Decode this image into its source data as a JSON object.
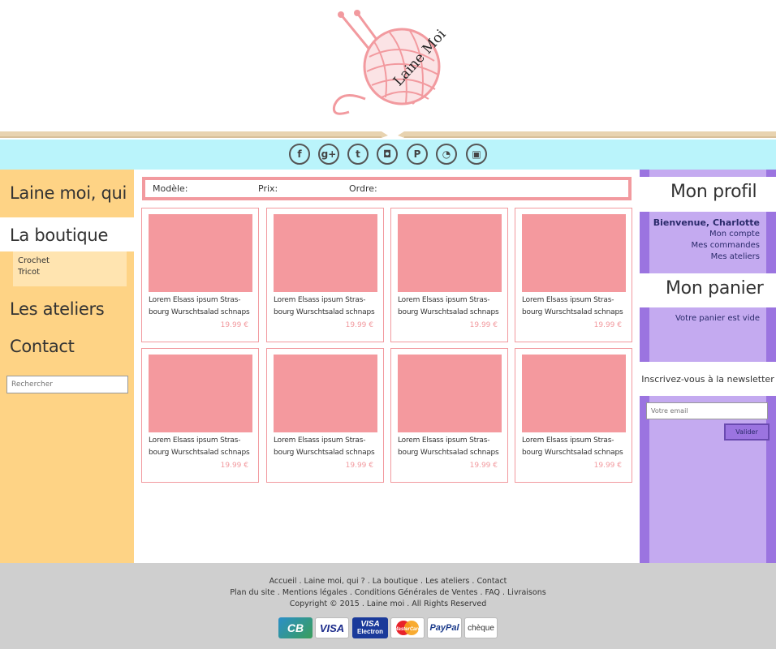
{
  "brand": {
    "logo_text": "Laine Moi",
    "colors": {
      "accent_pink": "#f29a9f",
      "sky": "#baf4fb",
      "sand": "#fed385",
      "lavender": "#c4aaf0",
      "purple": "#9b74e0"
    }
  },
  "social": [
    {
      "icon": "facebook-icon",
      "glyph": "f"
    },
    {
      "icon": "googleplus-icon",
      "glyph": "g+"
    },
    {
      "icon": "tumblr-icon",
      "glyph": "t"
    },
    {
      "icon": "instagram-icon",
      "glyph": "◘"
    },
    {
      "icon": "pinterest-icon",
      "glyph": "P"
    },
    {
      "icon": "rss-icon",
      "glyph": "◔"
    },
    {
      "icon": "youtube-icon",
      "glyph": "▣"
    }
  ],
  "nav": {
    "items": [
      "Laine moi, qui",
      "La boutique",
      "Les ateliers",
      "Contact"
    ],
    "sub": [
      "Crochet",
      "Tricot"
    ],
    "search_placeholder": "Rechercher"
  },
  "filter": {
    "model": "Modèle:",
    "price": "Prix:",
    "order": "Ordre:"
  },
  "products": [
    {
      "line1": "Lorem Elsass ipsum Stras-",
      "line2": "bourg Wurschtsalad schnaps",
      "price": "19.99 €"
    },
    {
      "line1": "Lorem Elsass ipsum Stras-",
      "line2": "bourg Wurschtsalad schnaps",
      "price": "19.99 €"
    },
    {
      "line1": "Lorem Elsass ipsum Stras-",
      "line2": "bourg Wurschtsalad schnaps",
      "price": "19.99 €"
    },
    {
      "line1": "Lorem Elsass ipsum Stras-",
      "line2": "bourg Wurschtsalad schnaps",
      "price": "19.99 €"
    },
    {
      "line1": "Lorem Elsass ipsum Stras-",
      "line2": "bourg Wurschtsalad schnaps",
      "price": "19.99 €"
    },
    {
      "line1": "Lorem Elsass ipsum Stras-",
      "line2": "bourg Wurschtsalad schnaps",
      "price": "19.99 €"
    },
    {
      "line1": "Lorem Elsass ipsum Stras-",
      "line2": "bourg Wurschtsalad schnaps",
      "price": "19.99 €"
    },
    {
      "line1": "Lorem Elsass ipsum Stras-",
      "line2": "bourg Wurschtsalad schnaps",
      "price": "19.99 €"
    }
  ],
  "profile": {
    "title": "Mon profil",
    "welcome": "Bienvenue, Charlotte",
    "links": [
      "Mon compte",
      "Mes commandes",
      "Mes ateliers"
    ]
  },
  "cart": {
    "title": "Mon panier",
    "empty": "Votre panier est vide"
  },
  "newsletter": {
    "title": "Inscrivez-vous à la newsletter",
    "placeholder": "Votre email",
    "button": "Valider"
  },
  "footer": {
    "line1": "Accueil . Laine moi, qui ? . La boutique . Les ateliers . Contact",
    "line2": "Plan du site . Mentions légales . Conditions Générales de Ventes . FAQ . Livraisons",
    "line3": "Copyright © 2015 . Laine moi . All Rights Reserved"
  },
  "payments": [
    {
      "icon": "cb-card-icon",
      "label": "CB"
    },
    {
      "icon": "visa-card-icon",
      "label": "VISA"
    },
    {
      "icon": "visa-electron-card-icon",
      "label": "VISA",
      "sub": "Electron"
    },
    {
      "icon": "mastercard-icon",
      "label": "MasterCard"
    },
    {
      "icon": "paypal-icon",
      "label": "PayPal"
    },
    {
      "icon": "cheque-icon",
      "label": "chèque"
    }
  ]
}
